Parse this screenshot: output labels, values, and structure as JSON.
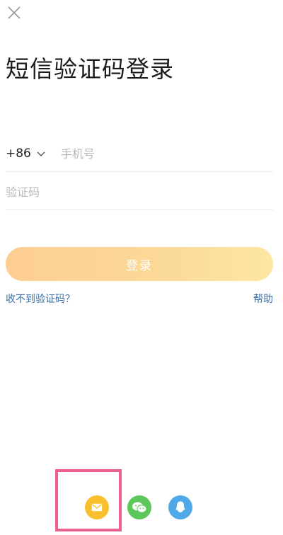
{
  "title": "短信验证码登录",
  "phone": {
    "country_code": "+86",
    "placeholder": "手机号",
    "value": ""
  },
  "code": {
    "placeholder": "验证码",
    "value": ""
  },
  "login_button_label": "登录",
  "links": {
    "not_received": "收不到验证码？",
    "help": "帮助"
  },
  "social_login": [
    {
      "name": "email-icon",
      "color": "#f9bf2f"
    },
    {
      "name": "wechat-icon",
      "color": "#5cc85a"
    },
    {
      "name": "qq-icon",
      "color": "#4fa8e8"
    }
  ],
  "colors": {
    "highlight": "#ee5f93",
    "link": "#3a6fa8",
    "login_gradient_start": "#fdc988",
    "login_gradient_end": "#fbe49a"
  }
}
